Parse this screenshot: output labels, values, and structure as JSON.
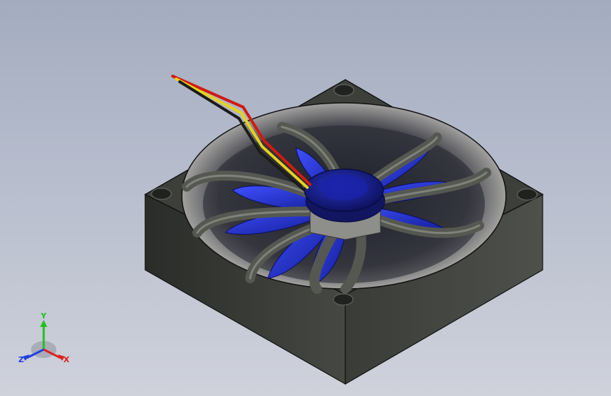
{
  "viewport": {
    "model": "axial-cooling-fan-with-wire-leads",
    "colors": {
      "background_top": "#a3acbf",
      "background_bottom": "#cfd2db",
      "frame": "#3b3d39",
      "frame_edge": "#121212",
      "blade": "#1e2fd0",
      "hub": "#1a1f9a",
      "wire_red": "#d01a12",
      "wire_yellow": "#e6d21a",
      "wire_black": "#1b1b1b"
    }
  },
  "triad": {
    "y_label": "Y",
    "x_label": "X",
    "z_label": "Z",
    "colors": {
      "x": "#e02020",
      "y": "#20c020",
      "z": "#2040e0"
    }
  }
}
